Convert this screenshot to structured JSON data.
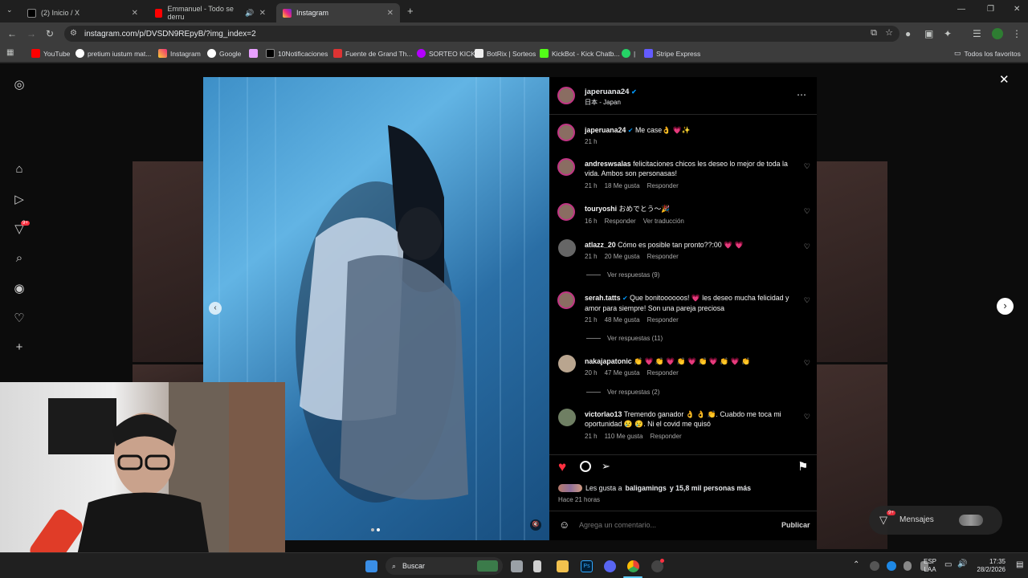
{
  "tabs": [
    {
      "title": "(2) Inicio / X"
    },
    {
      "title": "Emmanuel - Todo se derru"
    },
    {
      "title": "Instagram"
    }
  ],
  "address": {
    "url": "instagram.com/p/DVSDN9REpyB/?img_index=2"
  },
  "bookmarks": [
    "YouTube",
    "pretium iustum mat...",
    "Instagram",
    "Google",
    "10Notificaciones",
    "Fuente de Grand Th...",
    "SORTEO KICK",
    "BotRix | Sorteos",
    "KickBot - Kick Chatb...",
    "|",
    "Stripe Express",
    "Todos los favoritos"
  ],
  "sidebar": {
    "badge": "9+"
  },
  "post": {
    "username": "japeruana24",
    "location": "日本 - Japan",
    "caption_text": "Me case👌 💗✨",
    "caption_time": "21 h",
    "comments": [
      {
        "user": "andreswsalas",
        "text": "felicitaciones chicos les deseo lo mejor de toda la vida. Ambos son personasas!",
        "time": "21 h",
        "likes": "18 Me gusta",
        "reply": "Responder",
        "extra": ""
      },
      {
        "user": "touryoshi",
        "text": "おめでとう〜🎉",
        "time": "16 h",
        "likes": "",
        "reply": "Responder",
        "extra": "Ver traducción"
      },
      {
        "user": "atlazz_20",
        "text": "Cómo es posible tan pronto??:00 💗 💗",
        "time": "21 h",
        "likes": "20 Me gusta",
        "reply": "Responder",
        "extra": ""
      },
      {
        "user": "serah.tatts",
        "text": "Que bonitoooooos! 💗 les deseo mucha felicidad y amor para siempre! Son una pareja preciosa",
        "time": "21 h",
        "likes": "48 Me gusta",
        "reply": "Responder",
        "extra": ""
      },
      {
        "user": "nakajapatonic",
        "text": "👏 💗 👏 💗 👏 💗 👏 💗 👏 💗 👏",
        "time": "20 h",
        "likes": "47 Me gusta",
        "reply": "Responder",
        "extra": ""
      },
      {
        "user": "victorlao13",
        "text": "Tremendo ganador 👌 👌 👏. Cuabdo me toca mi oportunidad 😢 😢. Ni el covid me quisó",
        "time": "21 h",
        "likes": "110 Me gusta",
        "reply": "Responder",
        "extra": ""
      }
    ],
    "view_replies": [
      "Ver respuestas (9)",
      "Ver respuestas (11)",
      "Ver respuestas (2)"
    ],
    "likes_prefix": "Les gusta a",
    "likes_user": "baligamings",
    "likes_suffix": "y 15,8 mil personas más",
    "posted": "Hace 21 horas",
    "comment_placeholder": "Agrega un comentario...",
    "publish": "Publicar"
  },
  "messages_pill": "Mensajes",
  "messages_badge": "9+",
  "taskbar": {
    "search": "Buscar",
    "lang1": "ESP",
    "lang2": "LAA",
    "time": "17:35",
    "date": "28/2/2026"
  },
  "colors": {
    "accent": "#ff3040",
    "verified": "#0095f6",
    "panel_bg": "#000000"
  }
}
